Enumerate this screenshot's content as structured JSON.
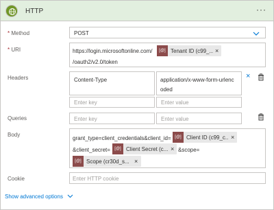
{
  "header": {
    "title": "HTTP",
    "more": "···"
  },
  "method": {
    "label": "Method",
    "required": "*",
    "value": "POST"
  },
  "uri": {
    "label": "URI",
    "required": "*",
    "prefix": "https://login.microsoftonline.com/",
    "token_icon": "[@]",
    "token_label": "Tenant ID (c99_...",
    "token_remove": "×",
    "suffix": "/oauth2/v2.0/token"
  },
  "headers": {
    "label": "Headers",
    "key": "Content-Type",
    "value_line1": "application/x-www-form-urlenc",
    "value_line2": "oded",
    "remove": "×",
    "key_placeholder": "Enter key",
    "value_placeholder": "Enter value"
  },
  "queries": {
    "label": "Queries",
    "key_placeholder": "Enter key",
    "value_placeholder": "Enter value"
  },
  "body": {
    "label": "Body",
    "text1": "grant_type=client_credentials&client_id=",
    "token1_icon": "[@]",
    "token1_label": "Client ID (c99_c...",
    "token1_remove": "×",
    "text2": "&client_secret=",
    "token2_icon": "[@]",
    "token2_label": "Client Secret (c...",
    "token2_remove": "×",
    "text3": "&scope=",
    "token3_icon": "[@]",
    "token3_label": "Scope (cr30d_s...",
    "token3_remove": "×"
  },
  "cookie": {
    "label": "Cookie",
    "placeholder": "Enter HTTP cookie"
  },
  "advanced": {
    "label": "Show advanced options"
  },
  "colors": {
    "header_bg": "#e2efdf",
    "icon_bg": "#709727",
    "token_icon_bg": "#8c4b4b",
    "accent": "#0078d4"
  },
  "icons": {
    "connector": "globe-icon",
    "delete": "trash-icon",
    "dropdown": "chevron-down-icon"
  }
}
